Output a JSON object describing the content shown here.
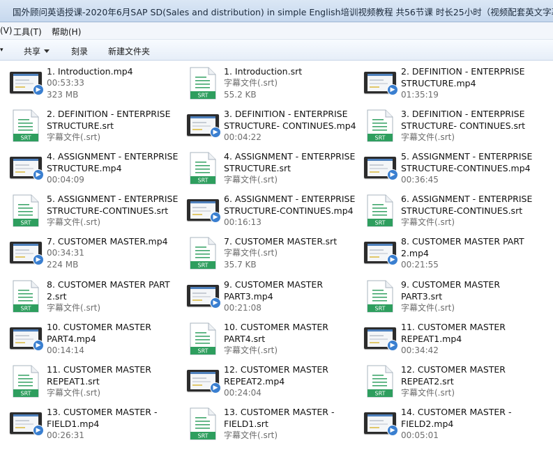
{
  "window": {
    "title": "国外顾问英语授课-2020年6月SAP SD(Sales and distribution) in simple English培训视频教程 共56节课 时长25小时（视频配套英文字幕）"
  },
  "menu": {
    "view": "(V)",
    "tools": "工具(T)",
    "help": "帮助(H)"
  },
  "toolbar": {
    "share": "共享",
    "burn": "刻录",
    "new_folder": "新建文件夹"
  },
  "icons": {
    "video": "video-thumbnail-icon",
    "subtitle": "srt-file-icon",
    "srt_badge": "SRT"
  },
  "colors": {
    "srt_green": "#2e9e5e",
    "selection_blue": "#4f81bd"
  },
  "files": [
    {
      "name": "1. Introduction.mp4",
      "type": "mp4",
      "sub1": "00:53:33",
      "sub2": "323 MB"
    },
    {
      "name": "1. Introduction.srt",
      "type": "srt",
      "sub1": "字幕文件(.srt)",
      "sub2": "55.2 KB"
    },
    {
      "name": "2. DEFINITION - ENTERPRISE STRUCTURE.mp4",
      "type": "mp4",
      "sub1": "01:35:19",
      "sub2": ""
    },
    {
      "name": "2. DEFINITION - ENTERPRISE STRUCTURE.srt",
      "type": "srt",
      "sub1": "字幕文件(.srt)",
      "sub2": ""
    },
    {
      "name": "3. DEFINITION - ENTERPRISE STRUCTURE- CONTINUES.mp4",
      "type": "mp4",
      "sub1": "00:04:22",
      "sub2": ""
    },
    {
      "name": "3. DEFINITION - ENTERPRISE STRUCTURE- CONTINUES.srt",
      "type": "srt",
      "sub1": "字幕文件(.srt)",
      "sub2": ""
    },
    {
      "name": "4. ASSIGNMENT - ENTERPRISE STRUCTURE.mp4",
      "type": "mp4",
      "sub1": "00:04:09",
      "sub2": ""
    },
    {
      "name": "4. ASSIGNMENT - ENTERPRISE STRUCTURE.srt",
      "type": "srt",
      "sub1": "字幕文件(.srt)",
      "sub2": ""
    },
    {
      "name": "5. ASSIGNMENT - ENTERPRISE STRUCTURE-CONTINUES.mp4",
      "type": "mp4",
      "sub1": "00:36:45",
      "sub2": ""
    },
    {
      "name": "5. ASSIGNMENT - ENTERPRISE STRUCTURE-CONTINUES.srt",
      "type": "srt",
      "sub1": "字幕文件(.srt)",
      "sub2": ""
    },
    {
      "name": "6. ASSIGNMENT - ENTERPRISE STRUCTURE-CONTINUES.mp4",
      "type": "mp4",
      "sub1": "00:16:13",
      "sub2": ""
    },
    {
      "name": "6. ASSIGNMENT - ENTERPRISE STRUCTURE-CONTINUES.srt",
      "type": "srt",
      "sub1": "字幕文件(.srt)",
      "sub2": ""
    },
    {
      "name": "7. CUSTOMER MASTER.mp4",
      "type": "mp4",
      "sub1": "00:34:31",
      "sub2": "224 MB"
    },
    {
      "name": "7. CUSTOMER MASTER.srt",
      "type": "srt",
      "sub1": "字幕文件(.srt)",
      "sub2": "35.7 KB"
    },
    {
      "name": "8. CUSTOMER MASTER PART 2.mp4",
      "type": "mp4",
      "sub1": "00:21:55",
      "sub2": ""
    },
    {
      "name": "8. CUSTOMER MASTER PART 2.srt",
      "type": "srt",
      "sub1": "字幕文件(.srt)",
      "sub2": ""
    },
    {
      "name": "9. CUSTOMER MASTER PART3.mp4",
      "type": "mp4",
      "sub1": "00:21:08",
      "sub2": ""
    },
    {
      "name": "9. CUSTOMER MASTER PART3.srt",
      "type": "srt",
      "sub1": "字幕文件(.srt)",
      "sub2": ""
    },
    {
      "name": "10. CUSTOMER MASTER PART4.mp4",
      "type": "mp4",
      "sub1": "00:14:14",
      "sub2": ""
    },
    {
      "name": "10. CUSTOMER MASTER PART4.srt",
      "type": "srt",
      "sub1": "字幕文件(.srt)",
      "sub2": ""
    },
    {
      "name": "11. CUSTOMER MASTER REPEAT1.mp4",
      "type": "mp4",
      "sub1": "00:34:42",
      "sub2": ""
    },
    {
      "name": "11. CUSTOMER MASTER REPEAT1.srt",
      "type": "srt",
      "sub1": "字幕文件(.srt)",
      "sub2": ""
    },
    {
      "name": "12. CUSTOMER MASTER REPEAT2.mp4",
      "type": "mp4",
      "sub1": "00:24:04",
      "sub2": ""
    },
    {
      "name": "12. CUSTOMER MASTER REPEAT2.srt",
      "type": "srt",
      "sub1": "字幕文件(.srt)",
      "sub2": ""
    },
    {
      "name": "13. CUSTOMER MASTER -FIELD1.mp4",
      "type": "mp4",
      "sub1": "00:26:31",
      "sub2": ""
    },
    {
      "name": "13. CUSTOMER MASTER -FIELD1.srt",
      "type": "srt",
      "sub1": "字幕文件(.srt)",
      "sub2": ""
    },
    {
      "name": "14. CUSTOMER MASTER -FIELD2.mp4",
      "type": "mp4",
      "sub1": "00:05:01",
      "sub2": ""
    }
  ]
}
